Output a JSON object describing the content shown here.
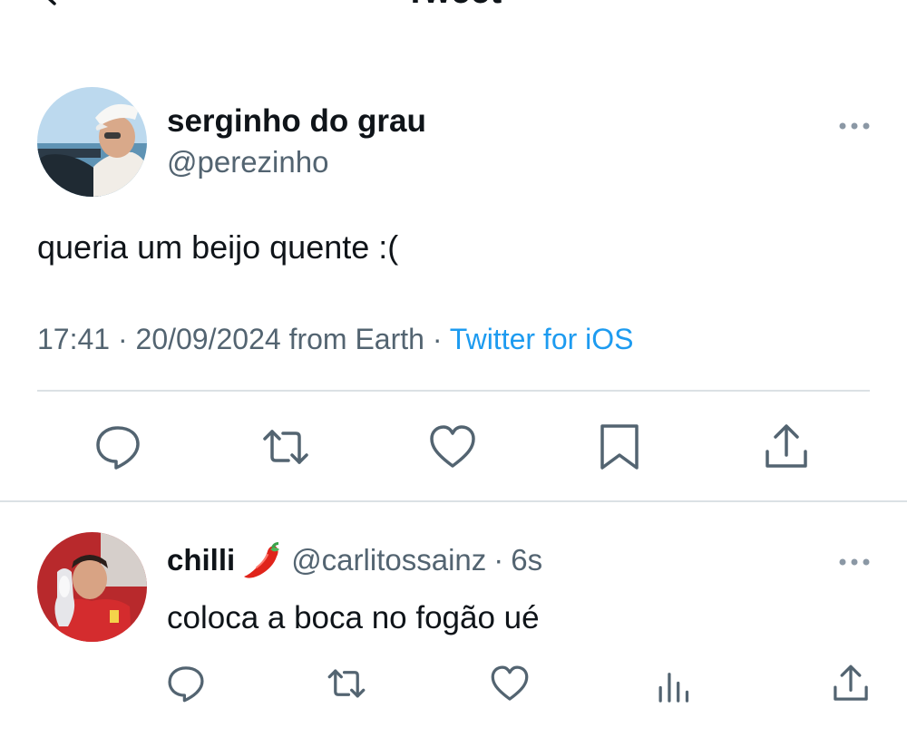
{
  "header": {
    "title": "Tweet",
    "back_icon": "chevron-left-icon"
  },
  "colors": {
    "text": "#0f1419",
    "secondary": "#536471",
    "link": "#1d9bf0",
    "divider": "#dbe1e5"
  },
  "main_tweet": {
    "display_name": "serginho do grau",
    "handle": "@perezinho",
    "text": "queria um beijo quente :(",
    "time": "17:41",
    "date": "20/09/2024",
    "location": "from Earth",
    "separator": "·",
    "source": "Twitter for iOS",
    "actions": [
      "reply-icon",
      "retweet-icon",
      "like-icon",
      "bookmark-icon",
      "share-icon"
    ]
  },
  "reply": {
    "display_name": "chilli",
    "emoji_icon": "chili-pepper-icon",
    "handle": "@carlitossainz",
    "separator": "·",
    "age": "6s",
    "text": "coloca a boca no fogão ué",
    "actions": [
      "reply-icon",
      "retweet-icon",
      "like-icon",
      "analytics-icon",
      "share-icon"
    ]
  }
}
